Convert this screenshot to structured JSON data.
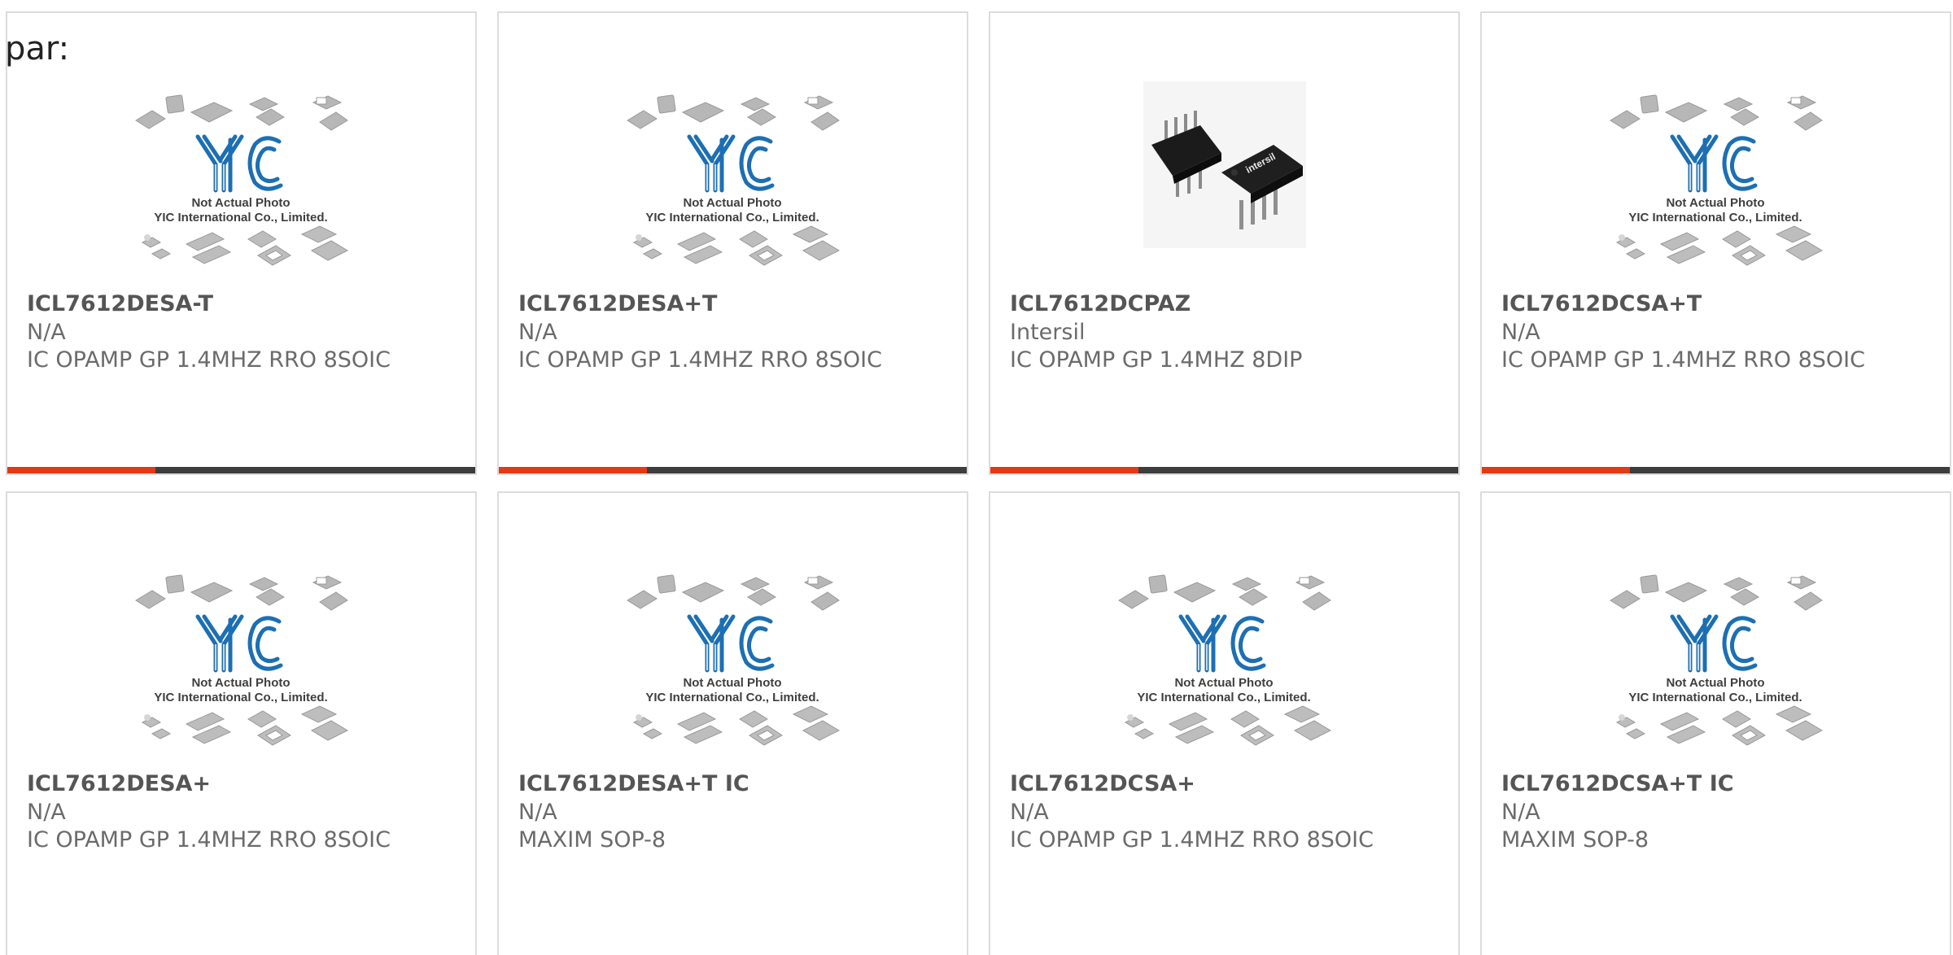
{
  "page": {
    "label": "par:"
  },
  "colors": {
    "accent": "#e23a16",
    "bar_track": "#3d3d3d",
    "card_border": "#dcdcdc",
    "logo_blue": "#1d6fb3",
    "placeholder_gray": "#b5b5b5"
  },
  "placeholder": {
    "caption_line1": "Not Actual Photo",
    "caption_line2": "YIC International Co., Limited.",
    "logo_text": "YIC"
  },
  "products": [
    {
      "part_number": "ICL7612DESA-T",
      "manufacturer": "N/A",
      "description": "IC OPAMP GP 1.4MHZ RRO 8SOIC",
      "image": "yic-placeholder-photo"
    },
    {
      "part_number": "ICL7612DESA+T",
      "manufacturer": "N/A",
      "description": "IC OPAMP GP 1.4MHZ RRO 8SOIC",
      "image": "yic-placeholder-photo"
    },
    {
      "part_number": "ICL7612DCPAZ",
      "manufacturer": "Intersil",
      "description": "IC OPAMP GP 1.4MHZ 8DIP",
      "image": "dip8-chip-photo",
      "image_text": "intersil"
    },
    {
      "part_number": "ICL7612DCSA+T",
      "manufacturer": "N/A",
      "description": "IC OPAMP GP 1.4MHZ RRO 8SOIC",
      "image": "yic-placeholder-photo"
    },
    {
      "part_number": "ICL7612DESA+",
      "manufacturer": "N/A",
      "description": "IC OPAMP GP 1.4MHZ RRO 8SOIC",
      "image": "yic-placeholder-photo"
    },
    {
      "part_number": "ICL7612DESA+T IC",
      "manufacturer": "N/A",
      "description": "MAXIM SOP-8",
      "image": "yic-placeholder-photo"
    },
    {
      "part_number": "ICL7612DCSA+",
      "manufacturer": "N/A",
      "description": "IC OPAMP GP 1.4MHZ RRO 8SOIC",
      "image": "yic-placeholder-photo"
    },
    {
      "part_number": "ICL7612DCSA+T IC",
      "manufacturer": "N/A",
      "description": "MAXIM SOP-8",
      "image": "yic-placeholder-photo"
    }
  ]
}
